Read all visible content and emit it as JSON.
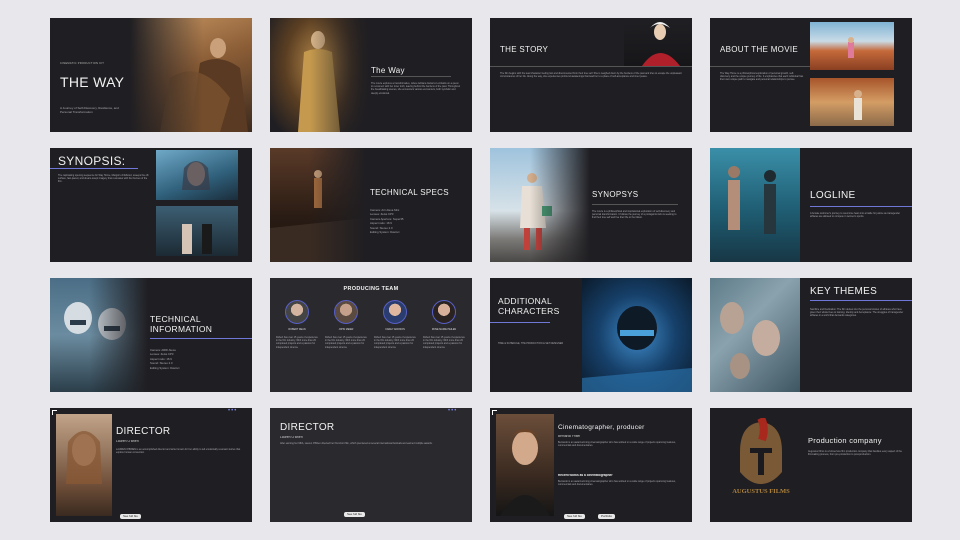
{
  "slides": {
    "s1": {
      "kicker": "CINEMATIC PRODUCTION KIT",
      "title": "THE WAY",
      "subtitle": "A Journey of Self-Discovery, Resilience, and Personal Transformation"
    },
    "s2": {
      "title": "The Way",
      "body": "The movie explores a transformative, where Adriana Gutierrez embarks on a quest to reconnect with her inner truth, leaving behind the burdens of the past. Throughout the breathtaking scenes, she encounters various encounters, both symbolic and deeply emotional."
    },
    "s3": {
      "title": "THE STORY",
      "body": "The film begins with the lead character feeling lost and disconnected from their true self. She is weighed down by the burdens of the past and tries to escape the unpleasant circumstances of her life. Along the way, she experiences profound awakenings that lead her to a place of self-acceptance and inner peace."
    },
    "s4": {
      "title": "ABOUT THE MOVIE",
      "body": "The Way Home is a philosophical exploration of personal growth, self-discovery and the unique journey of life. It emphasizes that each individual has their own unique path to navigate and personal relationships to pursue."
    },
    "s5": {
      "title": "SYNOPSIS:",
      "body": "The captivating opening sequence for Way Home, Margot's childhood, sweeps the off-surface, fast-paced, and dream-swept imagery that resonates with the themes of the film."
    },
    "s6": {
      "title": "TECHNICAL SPECS",
      "specs": [
        "Camera: Arri Alexa Mini",
        "Lenses: Zeiss CP3",
        "Camera Aperture: Super35",
        "Aspect ratio: 16:9",
        "Sound: Stereo 2.0",
        "Editing System: Davinci"
      ]
    },
    "s7": {
      "title": "SYNOPSYS",
      "body": "The movie is a philosophical and inspirational exploration of self-discovery and personal transformation. It follows the journey of a protagonist who is seeking to find their true self and live their life to the fullest."
    },
    "s8": {
      "title": "LOGLINE",
      "body": "A female swimmer's journey to overcome fears into a battle for justice as transgender athletes are allowed to compete in women's sports."
    },
    "s9": {
      "title": "TECHNICAL INFORMATION",
      "specs": [
        "Camera: ARRI Alexa",
        "Lenses: Zeiss CP3",
        "Aspect ratio: 16:9",
        "Sound: Stereo 2.0",
        "Editing System: Davinci"
      ]
    },
    "s10": {
      "title": "PRODUCING TEAM",
      "members": [
        "ROBERT DEAN",
        "JOHN MEIER",
        "CAREY ADDISON",
        "ROSE MARIE HEILEN"
      ],
      "body": "Robert has over 15 years of experience in the film industry. With more than 20 completed projects and a passion for independent cinema."
    },
    "s11": {
      "title": "ADDITIONAL CHARACTERS",
      "subtitle": "TIME & SCHEDULE, THE PRODUCTION & SET DESIGNER"
    },
    "s12": {
      "title": "KEY THEMES",
      "body": "Sacrifice and Dedication: The film delves into the personal stories of athletes who have given their whole lives to training. Identity and Acceptance: The struggles of transgender athletes in a world that demands categories."
    },
    "s13": {
      "dots": "•••",
      "title": "DIRECTOR",
      "name": "Lauren O'Brien",
      "body": "LAUREN O'BRIEN is an accomplished director and writer known for her ability to tell emotionally resonant stories that explore human connection.",
      "link": "See full bio"
    },
    "s14": {
      "dots": "•••",
      "title": "DIRECTOR",
      "name": "Lauren O'Brien",
      "body": "After earning her MFA, Lauren O'Brien directed her first short film, which premiered at several international festivals and earned multiple awards.",
      "link": "See full bio"
    },
    "s15": {
      "title": "Cinematographer, producer",
      "name": "Bernardo Fritter",
      "section": "Recent works as a cinematographer",
      "body": "Bernardo is an award-winning cinematographer who has worked on a wide range of projects spanning features, commercials and documentaries.",
      "link": "See full bio",
      "link2": "Portfolio"
    },
    "s16": {
      "title": "Production company",
      "body": "Augustus Films is a full-service film production company that handles every aspect of the filmmaking process, from pre-production to post-production.",
      "logo": "AUGUSTUS FILMS"
    }
  }
}
